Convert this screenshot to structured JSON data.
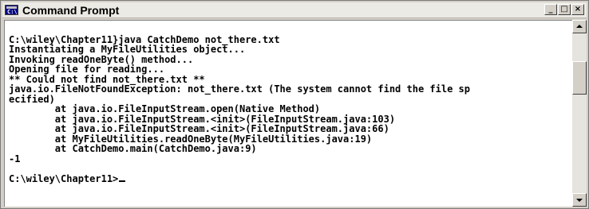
{
  "window": {
    "title": "Command Prompt",
    "icon": "console-window-icon",
    "icon_text": "C:\\",
    "controls": {
      "minimize": "_",
      "maximize": "□",
      "close": "×"
    }
  },
  "console": {
    "lines": [
      "",
      "C:\\wiley\\Chapter11}java CatchDemo not_there.txt",
      "Instantiating a MyFileUtilities object...",
      "Invoking readOneByte() method...",
      "Opening file for reading...",
      "** Could not find not_there.txt **",
      "java.io.FileNotFoundException: not_there.txt (The system cannot find the file sp",
      "ecified)",
      "        at java.io.FileInputStream.open(Native Method)",
      "        at java.io.FileInputStream.<init>(FileInputStream.java:103)",
      "        at java.io.FileInputStream.<init>(FileInputStream.java:66)",
      "        at MyFileUtilities.readOneByte(MyFileUtilities.java:19)",
      "        at CatchDemo.main(CatchDemo.java:9)",
      "-1",
      "",
      "C:\\wiley\\Chapter11>"
    ]
  },
  "scrollbar": {
    "position": 0.22
  }
}
